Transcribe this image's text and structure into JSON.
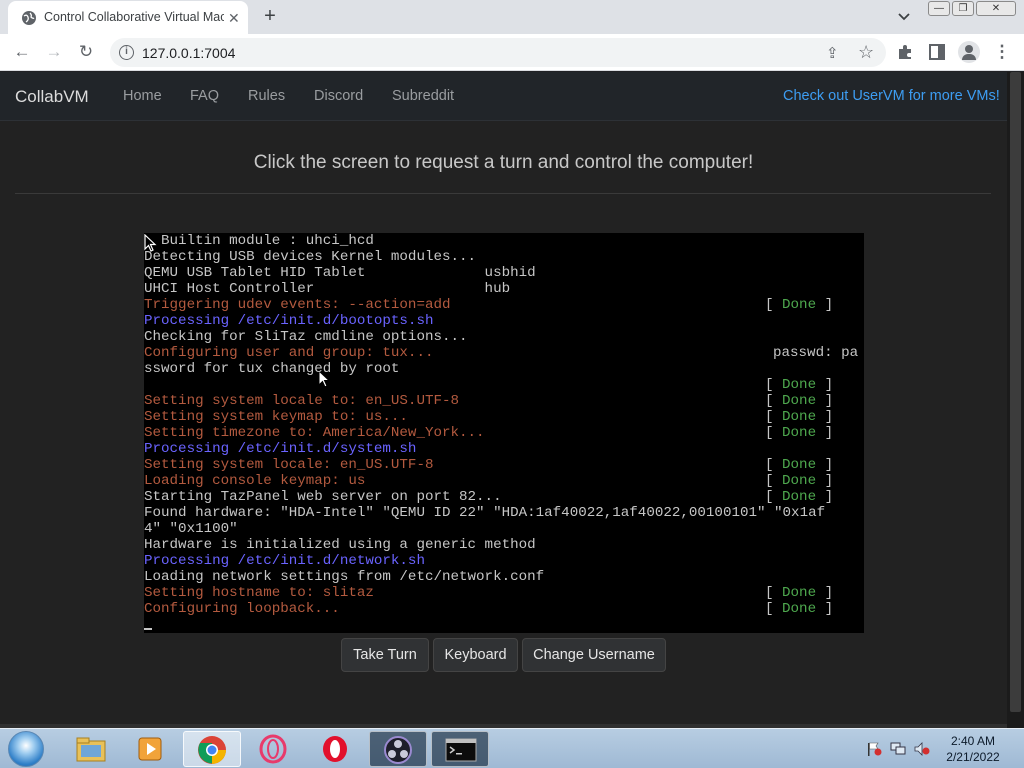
{
  "browser": {
    "tab_title": "Control Collaborative Virtual Mac",
    "tab_close": "✕",
    "new_tab": "+",
    "url": "127.0.0.1:7004",
    "window_controls": {
      "minimize": "—",
      "restore": "❐",
      "close": "✕"
    }
  },
  "nav": {
    "brand": "CollabVM",
    "links": [
      "Home",
      "FAQ",
      "Rules",
      "Discord",
      "Subreddit"
    ],
    "promo": "Check out UserVM for more VMs!"
  },
  "headline": "Click the screen to request a turn and control the computer!",
  "terminal": {
    "lines": [
      {
        "color": "white",
        "text": "  Builtin module : uhci_hcd"
      },
      {
        "color": "white",
        "text": "Detecting USB devices Kernel modules..."
      },
      {
        "color": "white",
        "text": "QEMU USB Tablet HID Tablet              usbhid"
      },
      {
        "color": "white",
        "text": "UHCI Host Controller                    hub"
      },
      {
        "color": "orange",
        "text": "Triggering udev events: --action=add",
        "done": true
      },
      {
        "color": "blue",
        "text": "Processing /etc/init.d/bootopts.sh"
      },
      {
        "color": "white",
        "text": "Checking for SliTaz cmdline options..."
      },
      {
        "color": "orange",
        "text": "Configuring user and group: tux...",
        "extra": "passwd: pa"
      },
      {
        "color": "white",
        "text": "ssword for tux changed by root"
      },
      {
        "color": "white",
        "text": "",
        "done": true
      },
      {
        "color": "orange",
        "text": "Setting system locale to: en_US.UTF-8",
        "done": true
      },
      {
        "color": "orange",
        "text": "Setting system keymap to: us...",
        "done": true
      },
      {
        "color": "orange",
        "text": "Setting timezone to: America/New_York...",
        "done": true
      },
      {
        "color": "blue",
        "text": "Processing /etc/init.d/system.sh"
      },
      {
        "color": "orange",
        "text": "Setting system locale: en_US.UTF-8",
        "done": true
      },
      {
        "color": "orange",
        "text": "Loading console keymap: us",
        "done": true
      },
      {
        "color": "white",
        "text": "Starting TazPanel web server on port 82...",
        "done": true
      },
      {
        "color": "white",
        "text": "Found hardware: \"HDA-Intel\" \"QEMU ID 22\" \"HDA:1af40022,1af40022,00100101\" \"0x1af"
      },
      {
        "color": "white",
        "text": "4\" \"0x1100\""
      },
      {
        "color": "white",
        "text": "Hardware is initialized using a generic method"
      },
      {
        "color": "blue",
        "text": "Processing /etc/init.d/network.sh"
      },
      {
        "color": "white",
        "text": "Loading network settings from /etc/network.conf"
      },
      {
        "color": "orange",
        "text": "Setting hostname to: slitaz",
        "done": true
      },
      {
        "color": "orange",
        "text": "Configuring loopback...",
        "done": true
      }
    ],
    "done_open": "[ ",
    "done_word": "Done",
    "done_close": " ]"
  },
  "buttons": {
    "take_turn": "Take Turn",
    "keyboard": "Keyboard",
    "change_username": "Change Username"
  },
  "taskbar": {
    "apps": [
      "windows-explorer",
      "media-player",
      "chrome",
      "opera-gx",
      "opera",
      "obs-studio",
      "command-prompt"
    ],
    "time": "2:40 AM",
    "date": "2/21/2022"
  }
}
